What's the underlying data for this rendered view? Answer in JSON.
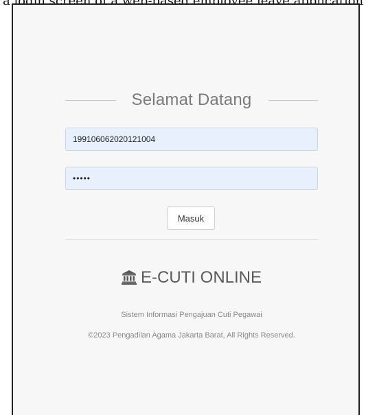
{
  "page": {
    "caption": "a login screen of a web-based employee leave application"
  },
  "login": {
    "heading": "Selamat Datang",
    "nip_value": "199106062020121004",
    "password_value": "•••••",
    "submit_label": "Masuk"
  },
  "footer": {
    "brand_icon": "institution-icon",
    "brand_name": "E-CUTI ONLINE",
    "tagline": "Sistem Informasi Pengajuan Cuti Pegawai",
    "copyright": "©2023 Pengadilan Agama Jakarta Barat, All Rights Reserved."
  }
}
